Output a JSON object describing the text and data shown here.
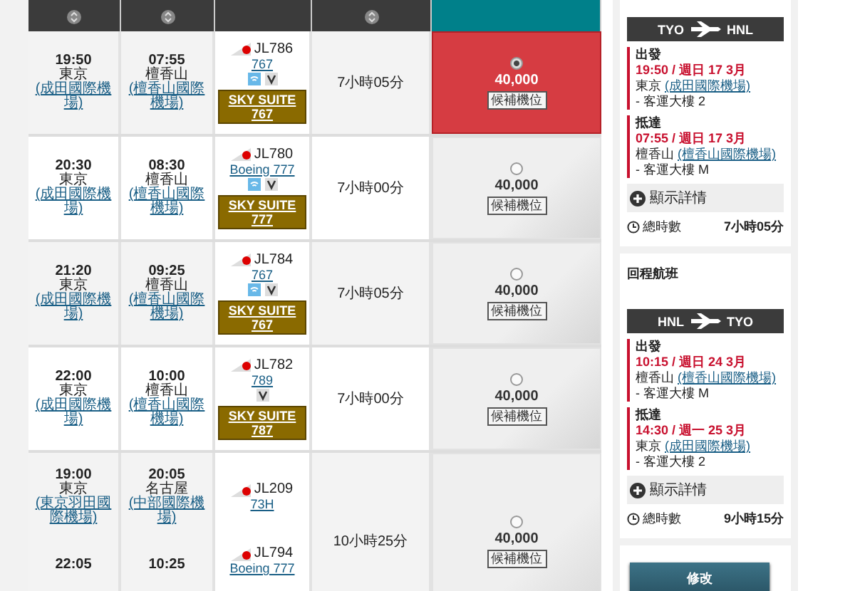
{
  "table": {
    "header": [
      {
        "sortable": true,
        "kind": "dark"
      },
      {
        "sortable": true,
        "kind": "dark"
      },
      {
        "sortable": false,
        "kind": "dark"
      },
      {
        "sortable": true,
        "kind": "dark"
      },
      {
        "sortable": false,
        "kind": "teal"
      }
    ],
    "itineraries": [
      {
        "legs": [
          {
            "dep_time": "19:50",
            "dep_city": "東京",
            "dep_airport": "(成田國際機場)",
            "arr_time": "07:55",
            "arr_city": "檀香山",
            "arr_airport": "(檀香山國際機場)",
            "flight_no": "JL786",
            "aircraft": "767",
            "amenities": [
              {
                "kind": "wifi"
              },
              {
                "kind": "screen"
              }
            ],
            "suite": [
              "SKY SUITE",
              "767"
            ]
          }
        ],
        "duration": "7小時05分",
        "fare": {
          "selected": true,
          "miles": "40,000",
          "button": "候補機位"
        }
      },
      {
        "legs": [
          {
            "dep_time": "20:30",
            "dep_city": "東京",
            "dep_airport": "(成田國際機場)",
            "arr_time": "08:30",
            "arr_city": "檀香山",
            "arr_airport": "(檀香山國際機場)",
            "flight_no": "JL780",
            "aircraft": "Boeing 777",
            "amenities": [
              {
                "kind": "wifi"
              },
              {
                "kind": "screen"
              }
            ],
            "suite": [
              "SKY SUITE",
              "777"
            ]
          }
        ],
        "duration": "7小時00分",
        "fare": {
          "selected": false,
          "miles": "40,000",
          "button": "候補機位"
        }
      },
      {
        "legs": [
          {
            "dep_time": "21:20",
            "dep_city": "東京",
            "dep_airport": "(成田國際機場)",
            "arr_time": "09:25",
            "arr_city": "檀香山",
            "arr_airport": "(檀香山國際機場)",
            "flight_no": "JL784",
            "aircraft": "767",
            "amenities": [
              {
                "kind": "wifi"
              },
              {
                "kind": "screen"
              }
            ],
            "suite": [
              "SKY SUITE",
              "767"
            ]
          }
        ],
        "duration": "7小時05分",
        "fare": {
          "selected": false,
          "miles": "40,000",
          "button": "候補機位"
        }
      },
      {
        "legs": [
          {
            "dep_time": "22:00",
            "dep_city": "東京",
            "dep_airport": "(成田國際機場)",
            "arr_time": "10:00",
            "arr_city": "檀香山",
            "arr_airport": "(檀香山國際機場)",
            "flight_no": "JL782",
            "aircraft": "789",
            "amenities": [
              {
                "kind": "screen"
              }
            ],
            "suite": [
              "SKY SUITE",
              "787"
            ]
          }
        ],
        "duration": "7小時00分",
        "fare": {
          "selected": false,
          "miles": "40,000",
          "button": "候補機位"
        }
      },
      {
        "legs": [
          {
            "dep_time": "19:00",
            "dep_city": "東京",
            "dep_airport": "(東京羽田國際機場)",
            "arr_time": "20:05",
            "arr_city": "名古屋",
            "arr_airport": "(中部國際機場)",
            "flight_no": "JL209",
            "aircraft": "73H"
          },
          {
            "dep_time": "22:05",
            "arr_time": "10:25",
            "flight_no": "JL794",
            "aircraft": "Boeing 777"
          }
        ],
        "duration": "10小時25分",
        "fare": {
          "selected": false,
          "miles": "40,000",
          "button": "候補機位"
        }
      }
    ]
  },
  "summary": {
    "outbound": {
      "from": "TYO",
      "to": "HNL",
      "stops": [
        {
          "label": "出發",
          "when": "19:50 / 週日 17 3月",
          "city": "東京",
          "airport": "(成田國際機場)",
          "terminal": "- 客運大樓 2"
        },
        {
          "label": "抵達",
          "when": "07:55 / 週日 17 3月",
          "city": "檀香山",
          "airport": "(檀香山國際機場)",
          "terminal": "- 客運大樓 M"
        }
      ],
      "details": "顯示詳情",
      "total_label": "總時數",
      "total": "7小時05分"
    },
    "return_title": "回程航班",
    "inbound": {
      "from": "HNL",
      "to": "TYO",
      "stops": [
        {
          "label": "出發",
          "when": "10:15 / 週日 24 3月",
          "city": "檀香山",
          "airport": "(檀香山國際機場)",
          "terminal": "- 客運大樓 M"
        },
        {
          "label": "抵達",
          "when": "14:30 / 週一 25 3月",
          "city": "東京",
          "airport": "(成田國際機場)",
          "terminal": "- 客運大樓 2"
        }
      ],
      "details": "顯示詳情",
      "total_label": "總時數",
      "total": "9小時15分"
    },
    "button": "修改"
  }
}
